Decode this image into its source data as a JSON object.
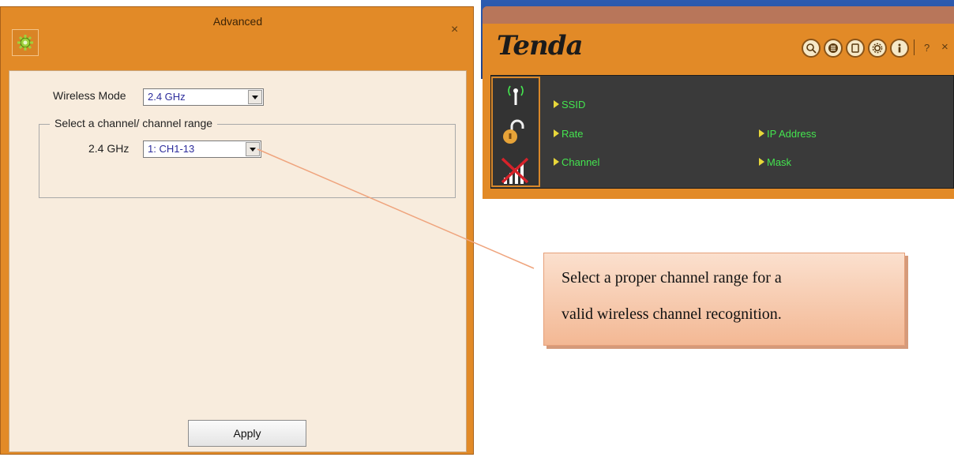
{
  "advanced": {
    "title": "Advanced",
    "close": "×",
    "wireless_mode_label": "Wireless Mode",
    "wireless_mode_value": "2.4 GHz",
    "group_title": "Select a channel/ channel range",
    "band_label": "2.4 GHz",
    "channel_value": "1: CH1-13",
    "apply_label": "Apply"
  },
  "tenda": {
    "logo": "Tenda",
    "toolbar_icons": [
      "search-icon",
      "list-icon",
      "document-icon",
      "settings-icon",
      "info-icon"
    ],
    "help": "?",
    "close": "×",
    "status": {
      "ssid": "SSID",
      "rate": "Rate",
      "channel": "Channel",
      "ip_address": "IP Address",
      "mask": "Mask"
    },
    "colors": {
      "frame": "#e28a27",
      "status_bg": "#3a3a3a",
      "status_text": "#44e44f"
    }
  },
  "callout": {
    "line1": "Select a proper channel range for a",
    "line2": "valid wireless channel recognition."
  }
}
